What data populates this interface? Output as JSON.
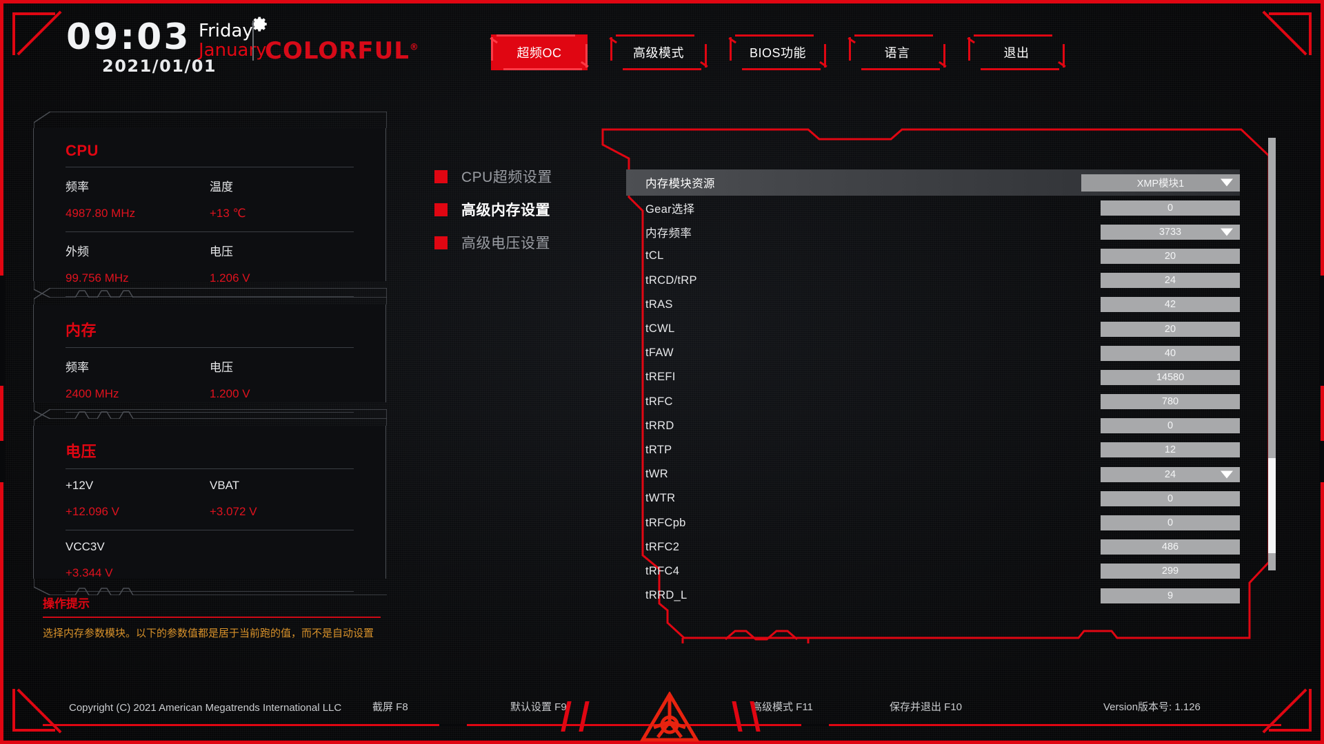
{
  "theme": {
    "red": "#e00612",
    "panel_bg": "#0d0e11",
    "value_red": "#e0121e",
    "hint_orange": "#d9922a",
    "field_grey": "#a8a9ab"
  },
  "header": {
    "time": "09:03",
    "date": "2021/01/01",
    "day_of_week": "Friday",
    "month": "January",
    "brand": "COLORFUL",
    "brand_mark": "®",
    "gear_icon": "gear-icon"
  },
  "nav": {
    "tabs": [
      {
        "label": "超频OC",
        "active": true
      },
      {
        "label": "高级模式",
        "active": false
      },
      {
        "label": "BIOS功能",
        "active": false
      },
      {
        "label": "语言",
        "active": false
      },
      {
        "label": "退出",
        "active": false
      }
    ]
  },
  "left_panels": [
    {
      "title": "CPU",
      "rows": [
        [
          {
            "key": "频率",
            "value": "4987.80 MHz"
          },
          {
            "key": "温度",
            "value": "+13 ℃"
          }
        ],
        [
          {
            "key": "外频",
            "value": "99.756 MHz"
          },
          {
            "key": "电压",
            "value": "1.206 V"
          }
        ]
      ]
    },
    {
      "title": "内存",
      "rows": [
        [
          {
            "key": "频率",
            "value": "2400 MHz"
          },
          {
            "key": "电压",
            "value": "1.200 V"
          }
        ]
      ]
    },
    {
      "title": "电压",
      "rows": [
        [
          {
            "key": "+12V",
            "value": "+12.096 V"
          },
          {
            "key": "VBAT",
            "value": "+3.072 V"
          }
        ],
        [
          {
            "key": "VCC3V",
            "value": "+3.344 V"
          },
          {
            "key": "",
            "value": ""
          }
        ]
      ]
    }
  ],
  "hint": {
    "title": "操作提示",
    "text": "选择内存参数模块。以下的参数值都是居于当前跑的值，而不是自动设置"
  },
  "mid_menu": {
    "items": [
      {
        "label": "CPU超频设置",
        "selected": false
      },
      {
        "label": "高级内存设置",
        "selected": true
      },
      {
        "label": "高级电压设置",
        "selected": false
      }
    ]
  },
  "settings": {
    "rows": [
      {
        "label": "内存模块资源",
        "value": "XMP模块1",
        "dropdown": true,
        "highlighted": true
      },
      {
        "label": "Gear选择",
        "value": "0",
        "dropdown": false,
        "highlighted": false
      },
      {
        "label": "内存频率",
        "value": "3733",
        "dropdown": true,
        "highlighted": false
      },
      {
        "label": "tCL",
        "value": "20",
        "dropdown": false,
        "highlighted": false
      },
      {
        "label": "tRCD/tRP",
        "value": "24",
        "dropdown": false,
        "highlighted": false
      },
      {
        "label": "tRAS",
        "value": "42",
        "dropdown": false,
        "highlighted": false
      },
      {
        "label": "tCWL",
        "value": "20",
        "dropdown": false,
        "highlighted": false
      },
      {
        "label": "tFAW",
        "value": "40",
        "dropdown": false,
        "highlighted": false
      },
      {
        "label": "tREFI",
        "value": "14580",
        "dropdown": false,
        "highlighted": false
      },
      {
        "label": "tRFC",
        "value": "780",
        "dropdown": false,
        "highlighted": false
      },
      {
        "label": "tRRD",
        "value": "0",
        "dropdown": false,
        "highlighted": false
      },
      {
        "label": "tRTP",
        "value": "12",
        "dropdown": false,
        "highlighted": false
      },
      {
        "label": "tWR",
        "value": "24",
        "dropdown": true,
        "highlighted": false
      },
      {
        "label": "tWTR",
        "value": "0",
        "dropdown": false,
        "highlighted": false
      },
      {
        "label": "tRFCpb",
        "value": "0",
        "dropdown": false,
        "highlighted": false
      },
      {
        "label": "tRFC2",
        "value": "486",
        "dropdown": false,
        "highlighted": false
      },
      {
        "label": "tRFC4",
        "value": "299",
        "dropdown": false,
        "highlighted": false
      },
      {
        "label": "tRRD_L",
        "value": "9",
        "dropdown": false,
        "highlighted": false
      }
    ],
    "scroll": {
      "thumb_top_pct": 74,
      "thumb_height_pct": 22
    }
  },
  "footer": {
    "copyright": "Copyright (C) 2021 American Megatrends International LLC",
    "items": [
      {
        "label": "截屏 F8"
      },
      {
        "label": "默认设置 F9"
      },
      {
        "label": "高级模式 F11"
      },
      {
        "label": "保存并退出 F10"
      }
    ],
    "version": "Version版本号: 1.126",
    "emblem": "colorful-star-emblem"
  }
}
